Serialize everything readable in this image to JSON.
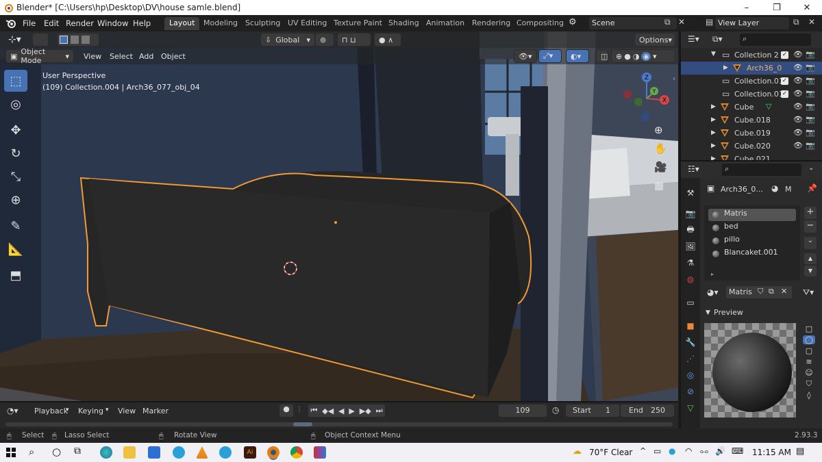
{
  "window": {
    "title": "Blender* [C:\\Users\\hp\\Desktop\\DV\\house samle.blend]",
    "minimize": "–",
    "maximize": "❐",
    "close": "✕"
  },
  "menu": [
    "File",
    "Edit",
    "Render",
    "Window",
    "Help"
  ],
  "workspaces": [
    "Layout",
    "Modeling",
    "Sculpting",
    "UV Editing",
    "Texture Paint",
    "Shading",
    "Animation",
    "Rendering",
    "Compositing"
  ],
  "active_workspace": "Layout",
  "scene": {
    "label": "Scene",
    "view_layer": "View Layer"
  },
  "viewport": {
    "orientation": "Global",
    "options": "Options",
    "mode": "Object Mode",
    "menus": [
      "View",
      "Select",
      "Add",
      "Object"
    ],
    "perspective": "User Perspective",
    "info": "(109) Collection.004 | Arch36_077_obj_04",
    "gizmo_axes": {
      "x": "X",
      "y": "Y",
      "z": "Z"
    }
  },
  "outliner": {
    "search_placeholder": "",
    "rows": [
      {
        "name": "Collection 2"
      },
      {
        "name": "Arch36_0"
      },
      {
        "name": "Collection.01"
      },
      {
        "name": "Collection.01"
      },
      {
        "name": "Cube"
      },
      {
        "name": "Cube.018"
      },
      {
        "name": "Cube.019"
      },
      {
        "name": "Cube.020"
      },
      {
        "name": "Cube.021"
      }
    ]
  },
  "properties": {
    "object_name": "Arch36_0...",
    "material_badge": "M",
    "slots": [
      "Matris",
      "bed",
      "pillo",
      "Blancaket.001"
    ],
    "selected_slot": "Matris",
    "material_field": "Matris",
    "preview_label": "Preview"
  },
  "timeline": {
    "menus": [
      "Playback",
      "Keying",
      "View",
      "Marker"
    ],
    "current_frame": "109",
    "start_label": "Start",
    "start": "1",
    "end_label": "End",
    "end": "250"
  },
  "statusbar": {
    "select": "Select",
    "lasso": "Lasso Select",
    "rotate": "Rotate View",
    "context": "Object Context Menu",
    "version": "2.93.3"
  },
  "taskbar": {
    "weather": "70°F  Clear",
    "time": "11:15 AM"
  },
  "colors": {
    "accent": "#4772b3",
    "outline": "#f29a36",
    "outliner_selected": "#334d80"
  }
}
